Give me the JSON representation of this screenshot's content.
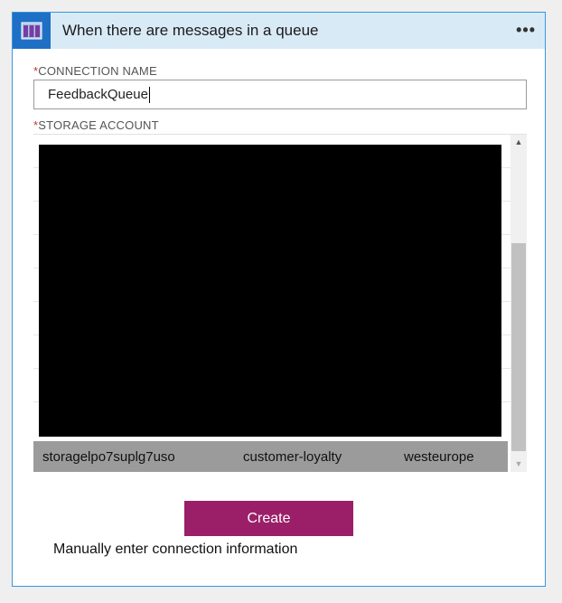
{
  "header": {
    "title": "When there are messages in a queue",
    "app_icon": "queue-icon",
    "menu_label": "•••"
  },
  "form": {
    "required_marker": "*",
    "connection_name_label": "CONNECTION NAME",
    "connection_name_value": "FeedbackQueue",
    "storage_account_label": "STORAGE ACCOUNT"
  },
  "storage_list": {
    "selected": {
      "name": "storagelpo7suplg7uso",
      "resource_group": "customer-loyalty",
      "location": "westeurope"
    }
  },
  "actions": {
    "create_label": "Create",
    "manual_link": "Manually enter connection information"
  },
  "colors": {
    "accent": "#9b1f68",
    "header_bg": "#d9eaf7",
    "border": "#3a96dd"
  }
}
